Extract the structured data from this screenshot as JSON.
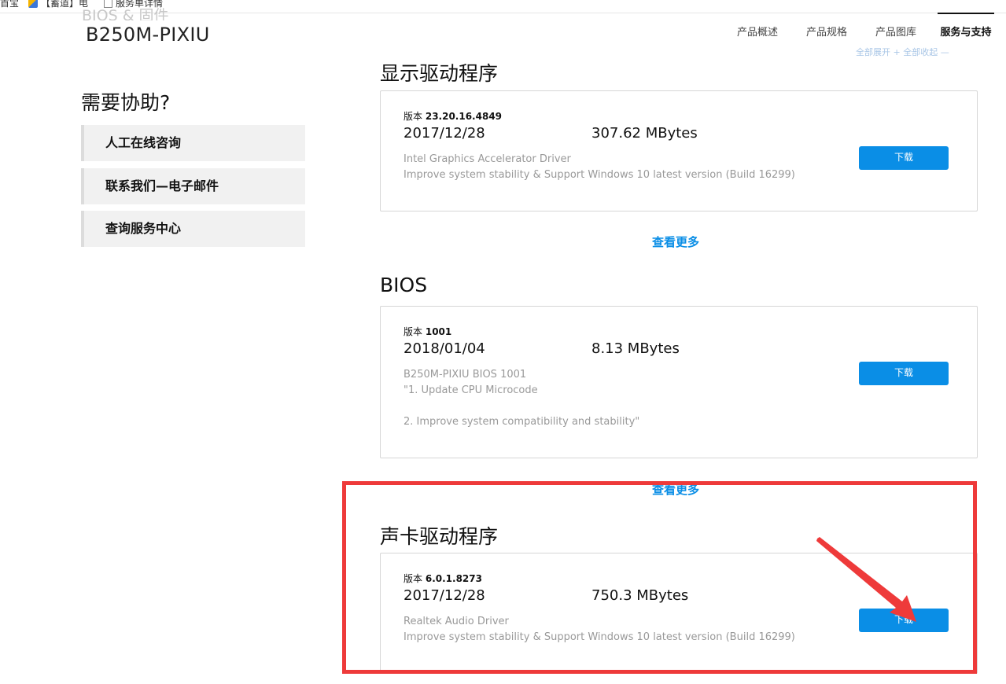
{
  "bookmarks": [
    "首宝",
    "【蓄道】电",
    "服务单详情"
  ],
  "ghost_heading": "BIOS & 固件",
  "product_title": "B250M-PIXIU",
  "nav": {
    "tabs": [
      "产品概述",
      "产品规格",
      "产品图库",
      "服务与支持"
    ],
    "active": "服务与支持",
    "sub_links": "全部展开 +    全部收起 —"
  },
  "help": {
    "title": "需要协助?",
    "buttons": [
      "人工在线咨询",
      "联系我们—电子邮件",
      "查询服务中心"
    ]
  },
  "sections": [
    {
      "title": "显示驱动程序",
      "version_prefix": "版本",
      "version": "23.20.16.4849",
      "date": "2017/12/28",
      "size": "307.62 MBytes",
      "description": "Intel Graphics Accelerator Driver\nImprove system stability & Support Windows 10 latest version (Build 16299)",
      "download_label": "下载",
      "see_more": "查看更多"
    },
    {
      "title": "BIOS",
      "version_prefix": "版本",
      "version": "1001",
      "date": "2018/01/04",
      "size": "8.13 MBytes",
      "description": "B250M-PIXIU BIOS 1001\n\"1. Update CPU Microcode\n\n2. Improve system compatibility and stability\"",
      "download_label": "下载",
      "see_more": "查看更多"
    },
    {
      "title": "声卡驱动程序",
      "version_prefix": "版本",
      "version": "6.0.1.8273",
      "date": "2017/12/28",
      "size": "750.3 MBytes",
      "description": "Realtek Audio Driver\nImprove system stability & Support Windows 10 latest version (Build 16299)",
      "download_label": "下载"
    }
  ],
  "annotation": {
    "color": "#ee3a3a"
  },
  "colors": {
    "accent": "#0a8ee6",
    "help_bg": "#f1f1f1",
    "muted_text": "#999999"
  }
}
